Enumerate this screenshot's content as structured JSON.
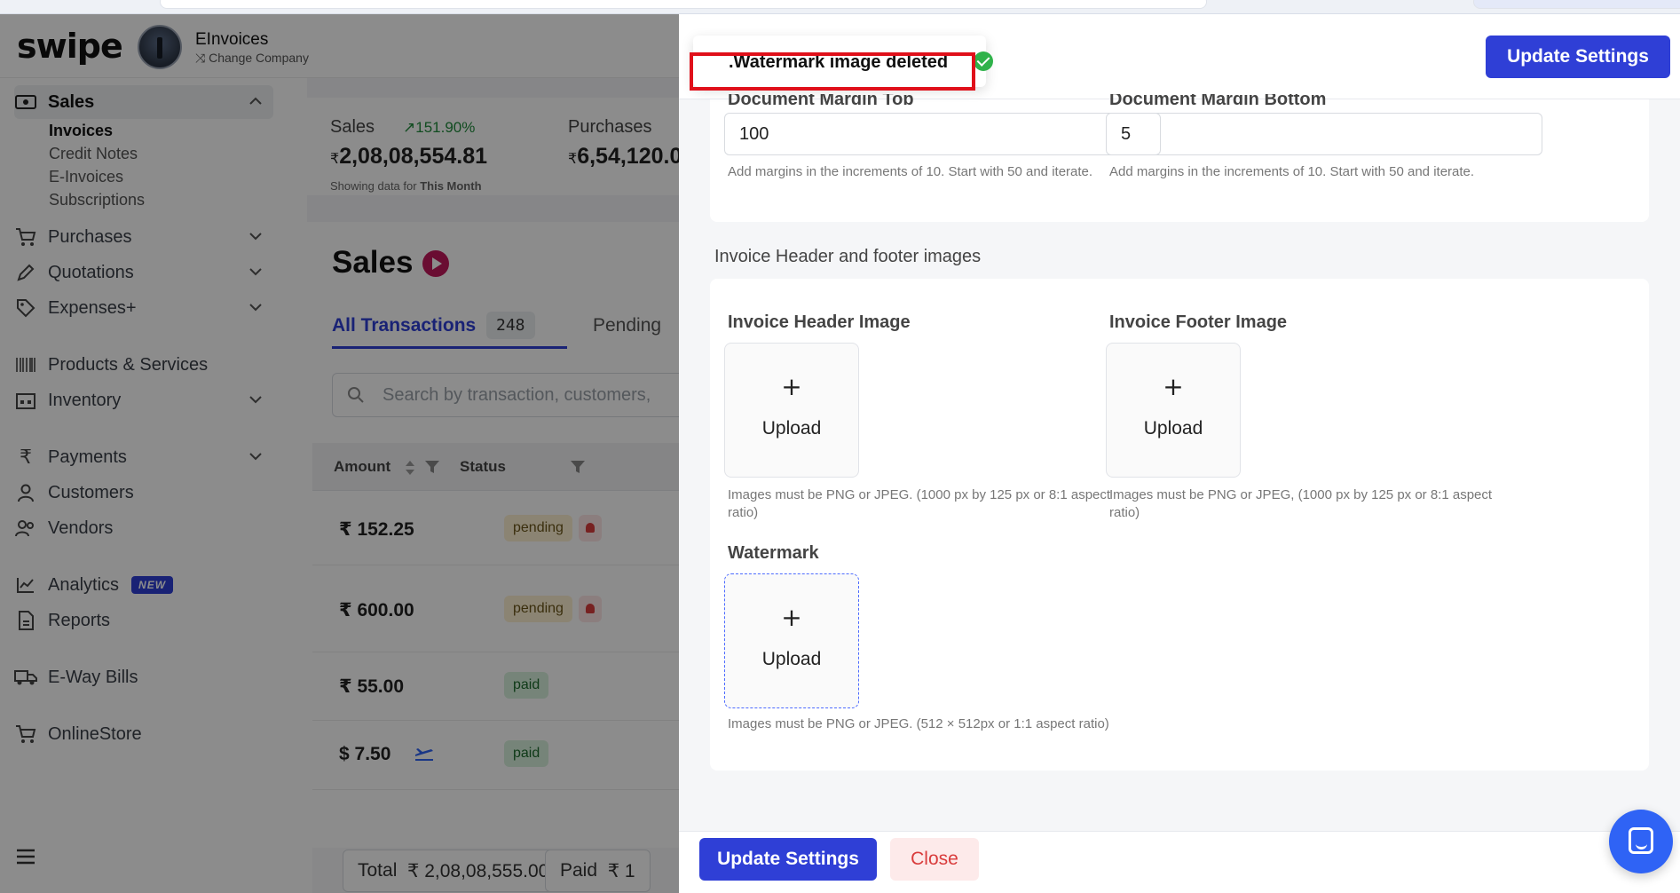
{
  "app": {
    "logo": "swipe",
    "company_name": "EInvoices",
    "change_company": "Change Company"
  },
  "sidebar": {
    "sales_label": "Sales",
    "sales_sub": [
      "Invoices",
      "Credit Notes",
      "E-Invoices",
      "Subscriptions"
    ],
    "purchases": "Purchases",
    "quotations": "Quotations",
    "expenses": "Expenses+",
    "products": "Products & Services",
    "inventory": "Inventory",
    "payments": "Payments",
    "customers": "Customers",
    "vendors": "Vendors",
    "analytics": "Analytics",
    "analytics_badge": "NEW",
    "reports": "Reports",
    "eway": "E-Way Bills",
    "onlinestore": "OnlineStore"
  },
  "stats": {
    "sales_label": "Sales",
    "sales_trend": "151.90%",
    "sales_value": "2,08,08,554.81",
    "purchases_label": "Purchases",
    "purchases_value": "6,54,120.0",
    "note_prefix": "Showing data for",
    "note_period": "This Month",
    "currency": "₹"
  },
  "sales": {
    "title": "Sales",
    "tab_all": "All Transactions",
    "tab_all_count": "248",
    "tab_pending": "Pending",
    "search_placeholder": "Search by transaction, customers,",
    "col_amount": "Amount",
    "col_status": "Status",
    "rows": [
      {
        "amount": "₹ 152.25",
        "status": "pending"
      },
      {
        "amount": "₹ 600.00",
        "status": "pending"
      },
      {
        "amount": "₹ 55.00",
        "status": "paid"
      },
      {
        "amount": "$ 7.50",
        "status": "paid"
      }
    ],
    "total_label": "Total",
    "total_value": "₹ 2,08,08,555.00",
    "paid_label": "Paid",
    "paid_value": "₹ 1"
  },
  "drawer": {
    "toast": ".Watermark image deleted",
    "update_settings": "Update Settings",
    "close": "Close",
    "margin_top_label": "Document Margin Top",
    "margin_top_value": "100",
    "margin_bottom_label": "Document Margin Bottom",
    "margin_bottom_value": "5",
    "margin_hint": "Add margins in the increments of 10. Start with 50 and iterate.",
    "images_section_title": "Invoice Header and footer images",
    "header_image_label": "Invoice Header Image",
    "footer_image_label": "Invoice Footer Image",
    "watermark_label": "Watermark",
    "upload_plus": "+",
    "upload_text": "Upload",
    "header_hint": "Images must be PNG or JPEG. (1000 px by 125 px or 8:1 aspect ratio)",
    "footer_hint": "Images must be PNG or JPEG, (1000 px by 125 px or 8:1 aspect ratio)",
    "watermark_hint": "Images must be PNG or JPEG. (512 × 512px or 1:1 aspect ratio)"
  },
  "colors": {
    "primary": "#2f3fd6",
    "danger": "#d93c3c",
    "success": "#2fb24a",
    "highlight": "#e0101a"
  }
}
